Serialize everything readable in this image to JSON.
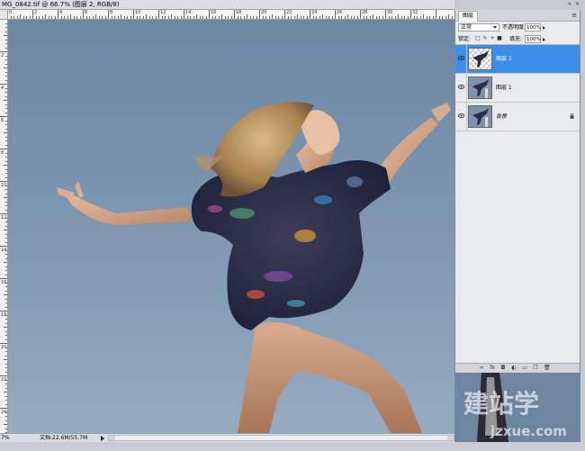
{
  "window": {
    "doc_title": "MG_0842.tif @ 66.7% (图层 2, RGB/8)"
  },
  "ruler": {
    "horizontal_labels": [
      "0",
      "2",
      "4",
      "6",
      "8",
      "10",
      "12",
      "14",
      "16",
      "18",
      "20",
      "22",
      "24",
      "26",
      "28",
      "30",
      "32"
    ],
    "vertical_labels": [
      "2",
      "4",
      "6",
      "8",
      "10",
      "12",
      "14",
      "16",
      "18",
      "20",
      "22",
      "24",
      "26"
    ]
  },
  "status": {
    "zoom": "7%",
    "doc_info": "文档:22.6M/55.7M"
  },
  "layers_panel": {
    "tab_label": "图层",
    "menu_icon": "panel-menu-icon",
    "blend_mode": "正常",
    "opacity_label": "不透明度:",
    "opacity_value": "100%",
    "lock_label": "锁定:",
    "fill_label": "填充:",
    "fill_value": "100%",
    "layers": [
      {
        "name": "图层 2",
        "active": true,
        "visible": true
      },
      {
        "name": "图层 1",
        "active": false,
        "visible": true
      },
      {
        "name": "背景",
        "active": false,
        "visible": true,
        "locked": true
      }
    ],
    "footer_icons": [
      "link-icon",
      "fx-icon",
      "mask-icon",
      "adjustment-icon",
      "group-icon",
      "new-layer-icon",
      "trash-icon"
    ]
  },
  "watermark": {
    "brand": "建站学",
    "url": "jzxue.com"
  },
  "colors": {
    "active_layer": "#3d8ee8",
    "panel_bg": "#e9eaed",
    "sky": "#7a93ae"
  }
}
